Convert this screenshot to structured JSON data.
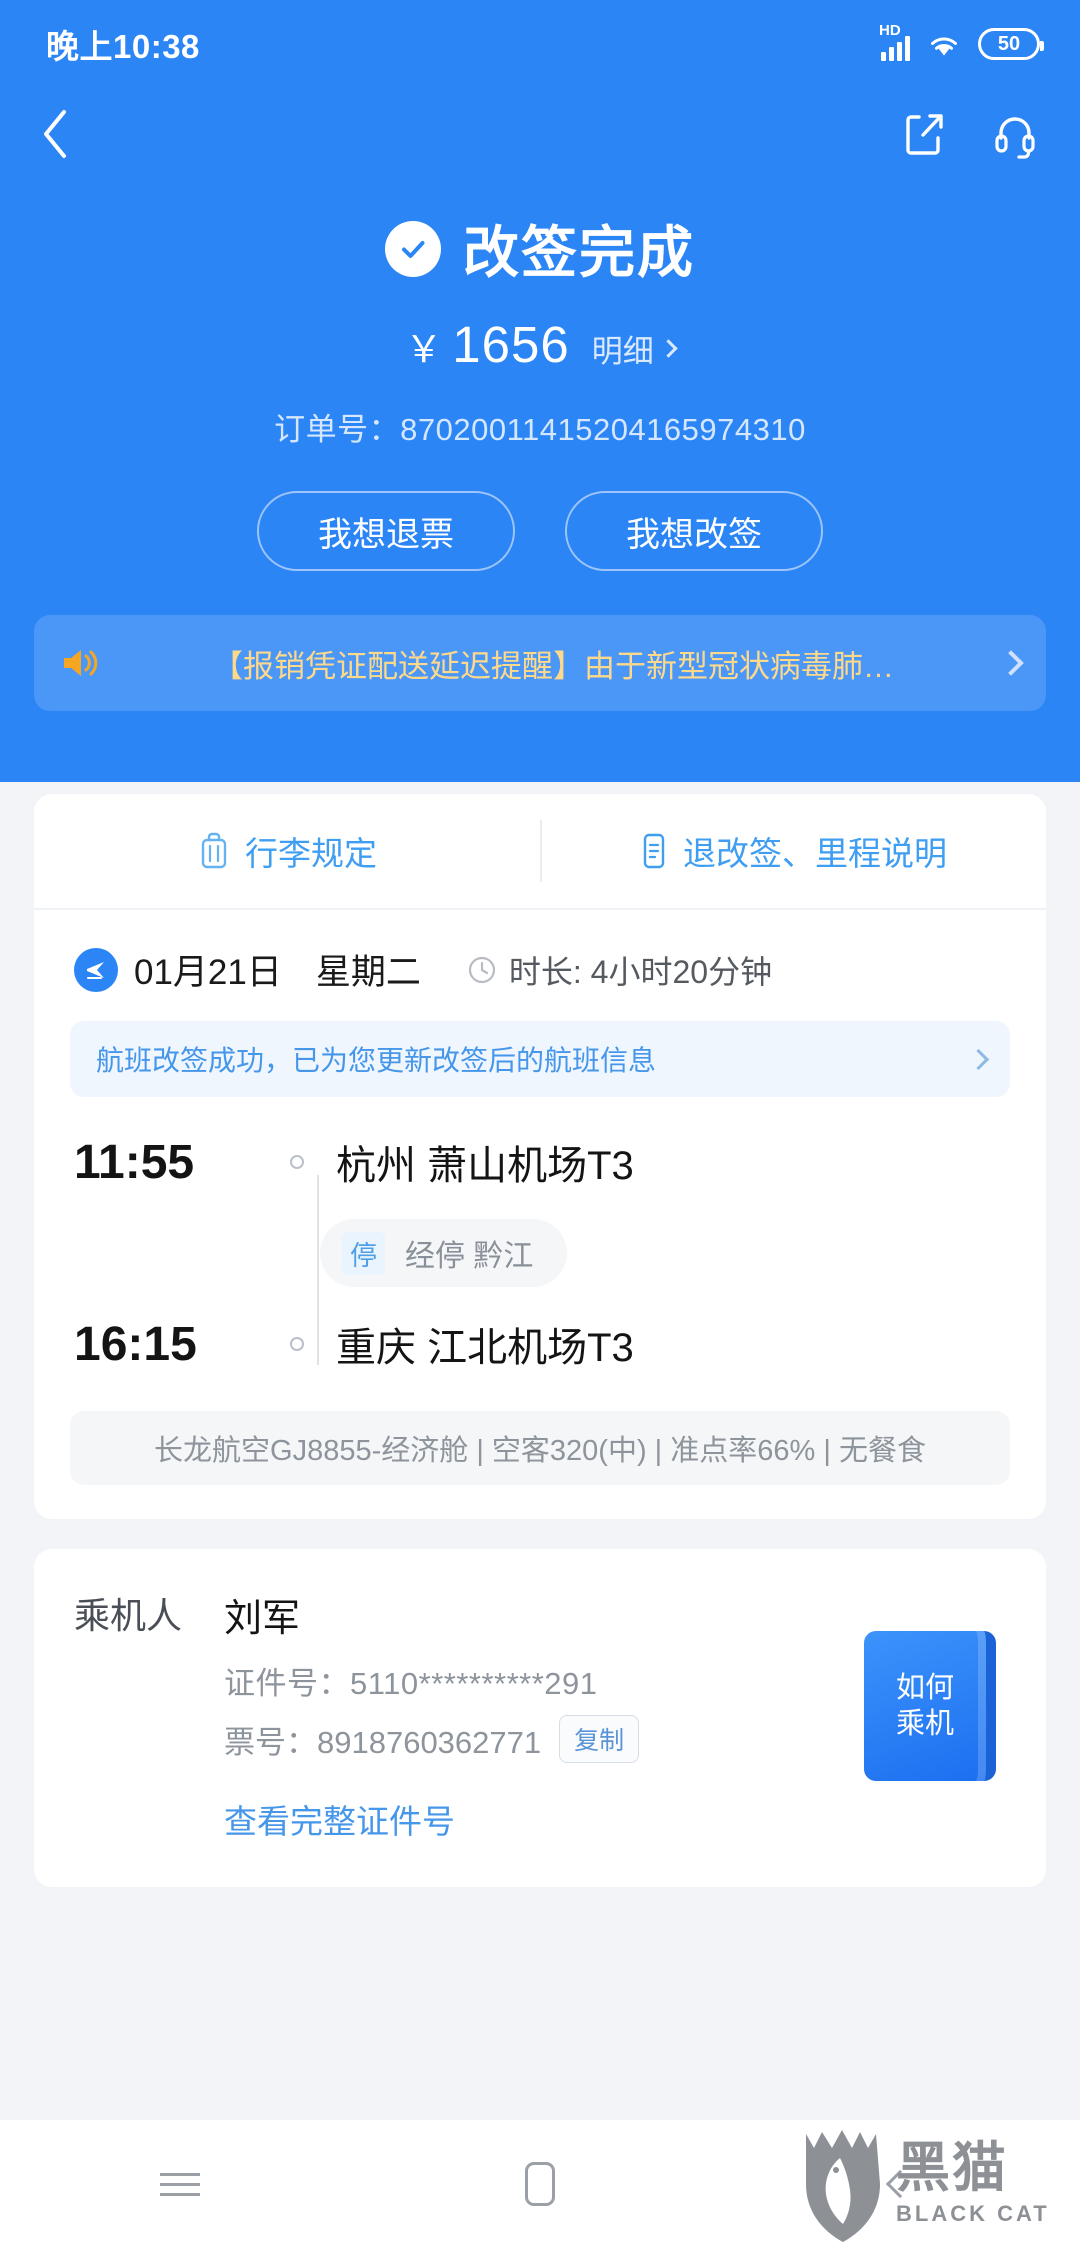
{
  "status_bar": {
    "time": "晚上10:38",
    "network_label": "HD",
    "battery_level": "50",
    "icons": [
      "hd-signal-icon",
      "wifi-icon",
      "battery-icon"
    ]
  },
  "top_nav": {
    "back_icon": "back-chevron-icon",
    "share_icon": "share-icon",
    "support_icon": "headset-icon"
  },
  "hero": {
    "status_icon": "check-circle-icon",
    "title": "改签完成",
    "currency": "￥",
    "amount": "1656",
    "detail_label": "明细",
    "order_label": "订单号：",
    "order_no": "87020011415204165974310",
    "order_line": "订单号：87020011415204165974310"
  },
  "actions": {
    "refund_label": "我想退票",
    "change_label": "我想改签"
  },
  "notice": {
    "icon": "speaker-icon",
    "text": "【报销凭证配送延迟提醒】由于新型冠状病毒肺…",
    "chevron": "chevron-right-icon"
  },
  "tabs": [
    {
      "label": "行李规定",
      "icon": "luggage-icon"
    },
    {
      "label": "退改签、里程说明",
      "icon": "document-icon"
    }
  ],
  "flight": {
    "plane_icon": "plane-icon",
    "date": "01月21日",
    "weekday": "星期二",
    "clock_icon": "clock-icon",
    "duration": "时长: 4小时20分钟",
    "success_note": "航班改签成功，已为您更新改签后的航班信息",
    "depart": {
      "time": "11:55",
      "place": "杭州 萧山机场T3"
    },
    "stop": {
      "badge": "停",
      "text": "经停 黔江"
    },
    "arrive": {
      "time": "16:15",
      "place": "重庆 江北机场T3"
    },
    "airline_info": "长龙航空GJ8855-经济舱 | 空客320(中) | 准点率66% | 无餐食"
  },
  "passenger": {
    "section_label": "乘机人",
    "name": "刘军",
    "id_line": "证件号：5110**********291",
    "ticket_line": "票号：8918760362771",
    "copy_label": "复制",
    "view_full_id_label": "查看完整证件号",
    "how_to_board_line1": "如何",
    "how_to_board_line2": "乘机"
  },
  "bottom_nav": {
    "recents_icon": "hamburger-icon",
    "home_icon": "home-icon",
    "back_icon": "back-chevron-icon"
  },
  "watermark": {
    "cn": "黑猫",
    "en": "BLACK CAT",
    "logo_icon": "black-cat-logo-icon"
  },
  "colors": {
    "brand_blue": "#2b85f5",
    "notice_text": "#ffd98a",
    "link_blue": "#4696ea",
    "page_bg": "#f2f4f7"
  }
}
